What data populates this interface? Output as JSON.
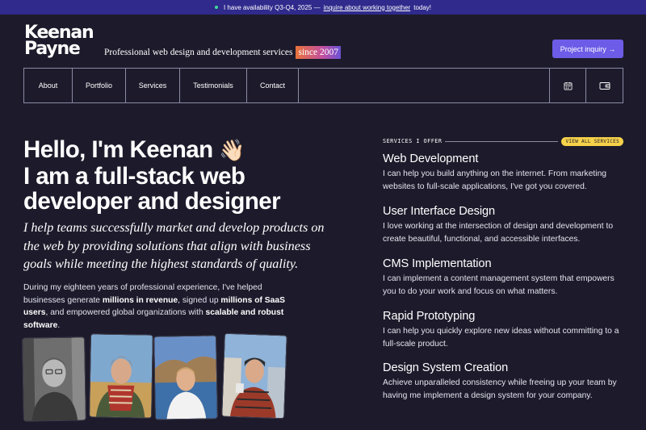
{
  "banner": {
    "text": "I have availability Q3-Q4, 2025  —",
    "link": "inquire about working together",
    "suffix": "today!"
  },
  "header": {
    "logo_line1": "Keenan",
    "logo_line2": "Payne",
    "tagline": "Professional web design and development services",
    "since": "since 2007",
    "cta": "Project inquiry →"
  },
  "nav": {
    "items": [
      {
        "label": "About"
      },
      {
        "label": "Portfolio"
      },
      {
        "label": "Services"
      },
      {
        "label": "Testimonials"
      },
      {
        "label": "Contact"
      }
    ],
    "icons": [
      "calendar-icon",
      "wallet-icon"
    ]
  },
  "hero": {
    "line1": "Hello, I'm Keenan",
    "wave": "👋🏻",
    "line2": "I am a full-stack web",
    "line3": "developer and designer",
    "lead": "I help teams successfully market and develop products on the web by providing solutions that align with business goals while meeting the highest standards of quality.",
    "body_1": "During my eighteen years of professional experience, I've helped businesses generate ",
    "body_b1": "millions in revenue",
    "body_2": ", signed up ",
    "body_b2": "millions of SaaS users",
    "body_3": ", and empowered global organizations with ",
    "body_b3": "scalable and robust software",
    "body_4": "."
  },
  "services": {
    "label": "SERVICES I OFFER",
    "view_all": "VIEW ALL SERVICES",
    "items": [
      {
        "title": "Web Development",
        "desc": "I can help you build anything on the internet. From marketing websites to full-scale applications, I've got you covered."
      },
      {
        "title": "User Interface Design",
        "desc": "I love working at the intersection of design and development to create beautiful, functional, and accessible interfaces."
      },
      {
        "title": "CMS Implementation",
        "desc": "I can implement a content management system that empowers you to do your work and focus on what matters."
      },
      {
        "title": "Rapid Prototyping",
        "desc": "I can help you quickly explore new ideas without committing to a full-scale product."
      },
      {
        "title": "Design System Creation",
        "desc": "Achieve unparalleled consistency while freeing up your team by having me implement a design system for your company."
      }
    ]
  },
  "colors": {
    "background": "#1d1b2b",
    "banner": "#2f2a8c",
    "accent": "#6c5ce7",
    "badge": "#f6d24a"
  }
}
